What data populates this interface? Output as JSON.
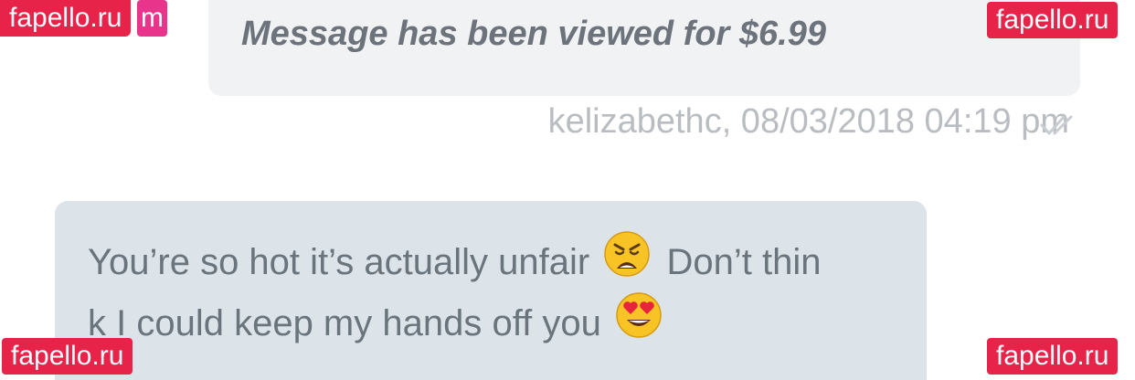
{
  "outgoing": {
    "text": "Message has been viewed for $6.99",
    "meta": "kelizabethc, 08/03/2018 04:19 pm"
  },
  "incoming": {
    "line1a": "You’re so hot it’s actually unfair",
    "line1b": "Don’t thin",
    "line2": "k I could keep my hands off you",
    "emoji1": "weary-face-icon",
    "emoji2": "heart-eyes-face-icon"
  },
  "watermark": {
    "text": "fapello.ru",
    "partial": "m"
  },
  "colors": {
    "outgoing_bubble": "#f1f2f4",
    "incoming_bubble": "#dde4e9",
    "watermark": "#e8234a"
  }
}
